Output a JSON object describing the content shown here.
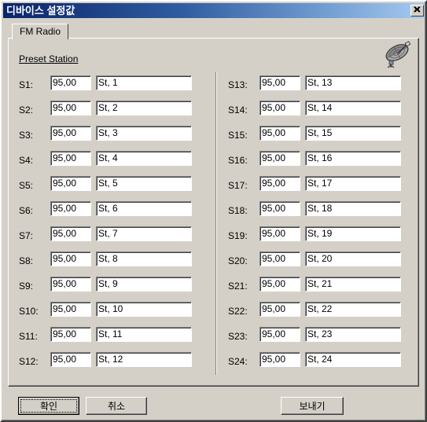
{
  "window": {
    "title": "디바이스 설정값",
    "close_label": "✕",
    "close_icon": "close-icon"
  },
  "tabs": [
    {
      "label": "FM Radio",
      "active": true
    }
  ],
  "panel": {
    "section_title": "Preset Station",
    "dish_icon": "satellite-dish-icon"
  },
  "presets": {
    "left": [
      {
        "label": "S1:",
        "freq": "95,00",
        "name": "St, 1"
      },
      {
        "label": "S2:",
        "freq": "95,00",
        "name": "St, 2"
      },
      {
        "label": "S3:",
        "freq": "95,00",
        "name": "St, 3"
      },
      {
        "label": "S4:",
        "freq": "95,00",
        "name": "St, 4"
      },
      {
        "label": "S5:",
        "freq": "95,00",
        "name": "St, 5"
      },
      {
        "label": "S6:",
        "freq": "95,00",
        "name": "St, 6"
      },
      {
        "label": "S7:",
        "freq": "95,00",
        "name": "St, 7"
      },
      {
        "label": "S8:",
        "freq": "95,00",
        "name": "St, 8"
      },
      {
        "label": "S9:",
        "freq": "95,00",
        "name": "St, 9"
      },
      {
        "label": "S10:",
        "freq": "95,00",
        "name": "St, 10"
      },
      {
        "label": "S11:",
        "freq": "95,00",
        "name": "St, 11"
      },
      {
        "label": "S12:",
        "freq": "95,00",
        "name": "St, 12"
      }
    ],
    "right": [
      {
        "label": "S13:",
        "freq": "95,00",
        "name": "St, 13"
      },
      {
        "label": "S14:",
        "freq": "95,00",
        "name": "St, 14"
      },
      {
        "label": "S15:",
        "freq": "95,00",
        "name": "St, 15"
      },
      {
        "label": "S16:",
        "freq": "95,00",
        "name": "St, 16"
      },
      {
        "label": "S17:",
        "freq": "95,00",
        "name": "St, 17"
      },
      {
        "label": "S18:",
        "freq": "95,00",
        "name": "St, 18"
      },
      {
        "label": "S19:",
        "freq": "95,00",
        "name": "St, 19"
      },
      {
        "label": "S20:",
        "freq": "95,00",
        "name": "St, 20"
      },
      {
        "label": "S21:",
        "freq": "95,00",
        "name": "St, 21"
      },
      {
        "label": "S22:",
        "freq": "95,00",
        "name": "St, 22"
      },
      {
        "label": "S23:",
        "freq": "95,00",
        "name": "St, 23"
      },
      {
        "label": "S24:",
        "freq": "95,00",
        "name": "St, 24"
      }
    ]
  },
  "buttons": {
    "ok": "확인",
    "cancel": "취소",
    "send": "보내기"
  },
  "colors": {
    "face": "#d4d0c8",
    "title_start": "#0a246a",
    "title_end": "#a6caf0",
    "field_bg": "#ffffff",
    "text": "#000000"
  }
}
